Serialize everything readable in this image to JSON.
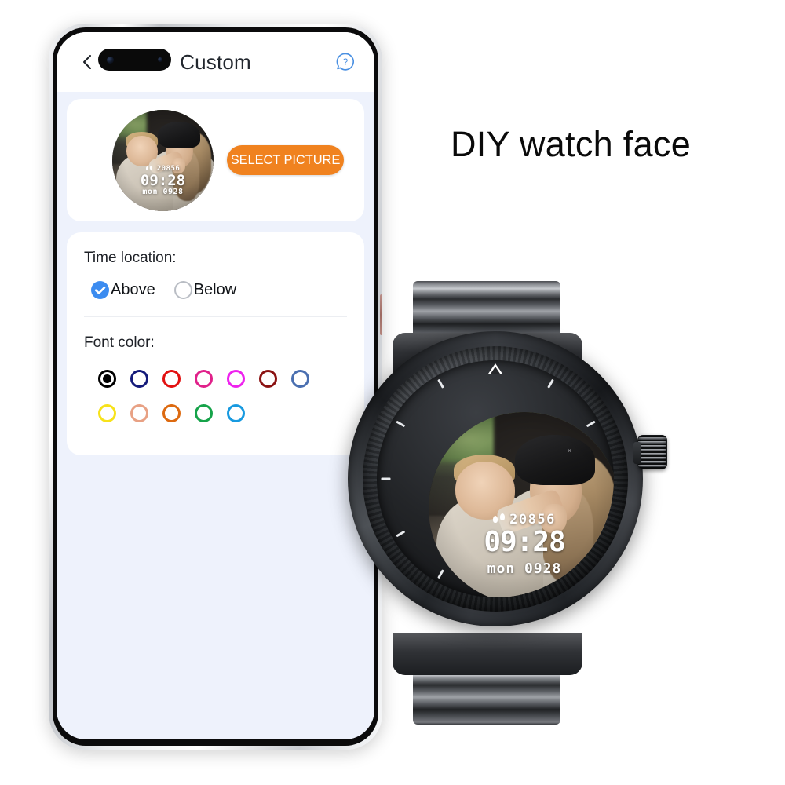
{
  "page": {
    "headline": "DIY watch face",
    "background_color": "#ffffff"
  },
  "phone": {
    "app": {
      "header": {
        "title": "Custom",
        "back_icon": "back-chevron-icon",
        "help_icon": "help-question-icon",
        "help_color": "#4a90e2",
        "camera_cutout": "dual-camera-pill"
      },
      "preview_card": {
        "select_button_label": "SELECT PICTURE",
        "select_button_color": "#f0821f",
        "watch_preview": {
          "steps": "20856",
          "time": "09:28",
          "date": "mon 0928",
          "steps_icon": "footprints-icon"
        }
      },
      "options_card": {
        "time_location": {
          "label": "Time location:",
          "options": [
            {
              "label": "Above",
              "selected": true
            },
            {
              "label": "Below",
              "selected": false
            }
          ],
          "selected_color": "#3c8cf0"
        },
        "font_color": {
          "label": "Font color:",
          "swatches": [
            {
              "name": "black",
              "hex": "#000000",
              "selected": true
            },
            {
              "name": "navy",
              "hex": "#141a7a",
              "selected": false
            },
            {
              "name": "red",
              "hex": "#e21111",
              "selected": false
            },
            {
              "name": "pink",
              "hex": "#e0218a",
              "selected": false
            },
            {
              "name": "magenta",
              "hex": "#ee22ee",
              "selected": false
            },
            {
              "name": "dark-red",
              "hex": "#8b1212",
              "selected": false
            },
            {
              "name": "steel-blue",
              "hex": "#4a6fb0",
              "selected": false
            },
            {
              "name": "yellow",
              "hex": "#f7e21a",
              "selected": false
            },
            {
              "name": "salmon",
              "hex": "#e8a184",
              "selected": false
            },
            {
              "name": "orange",
              "hex": "#dd6a10",
              "selected": false
            },
            {
              "name": "green",
              "hex": "#16a34a",
              "selected": false
            },
            {
              "name": "sky-blue",
              "hex": "#189ae0",
              "selected": false
            }
          ]
        }
      }
    }
  },
  "watch": {
    "face": {
      "steps": "20856",
      "time": "09:28",
      "date": "mon 0928",
      "steps_icon": "footprints-icon",
      "top_marker": "triangle-marker",
      "text_color": "#ffffff"
    },
    "hardware": {
      "crown": "rotating-crown",
      "band": "metal-link-bracelet",
      "case_color": "#23262a"
    }
  }
}
